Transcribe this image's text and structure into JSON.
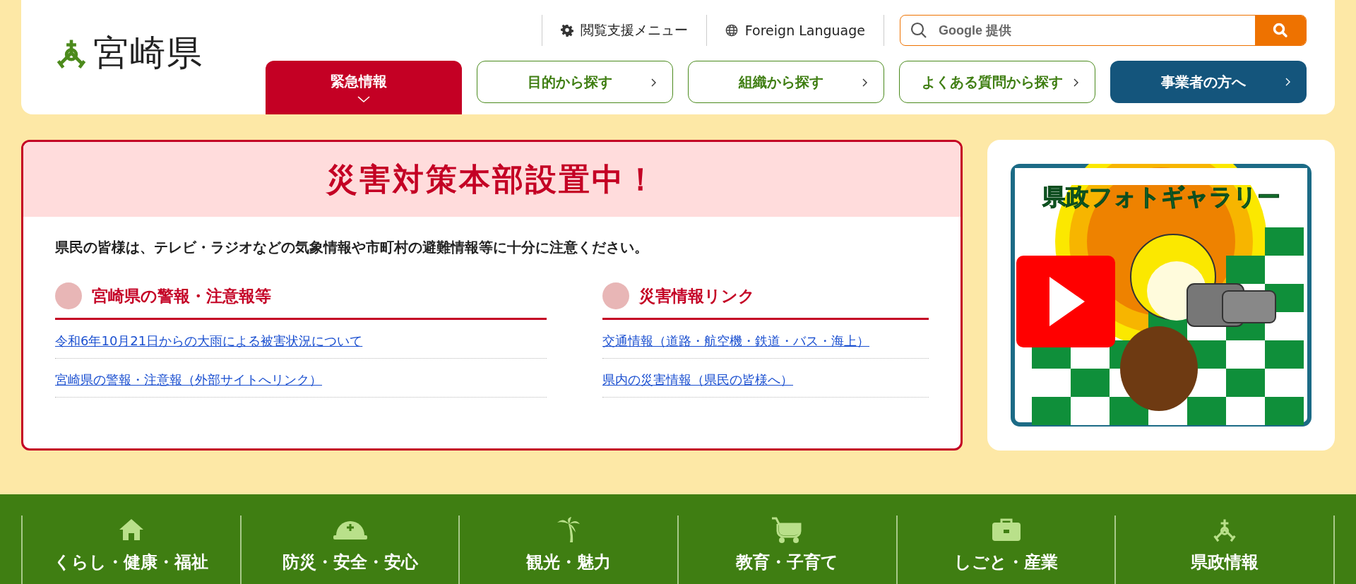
{
  "header": {
    "logo_text": "宮崎県",
    "utility_links": [
      {
        "label": "閲覧支援メニュー"
      },
      {
        "label": "Foreign Language"
      }
    ],
    "search": {
      "placeholder": "Google 提供"
    },
    "nav_tabs": [
      {
        "label": "緊急情報",
        "kind": "emergency"
      },
      {
        "label": "目的から探す",
        "kind": "outline"
      },
      {
        "label": "組織から探す",
        "kind": "outline"
      },
      {
        "label": "よくある質問から探す",
        "kind": "outline"
      },
      {
        "label": "事業者の方へ",
        "kind": "business"
      }
    ]
  },
  "alert": {
    "title": "災害対策本部設置中！",
    "notice": "県民の皆様は、テレビ・ラジオなどの気象情報や市町村の避難情報等に十分に注意ください。",
    "sections": [
      {
        "heading": "宮崎県の警報・注意報等",
        "links": [
          "令和6年10月21日からの大雨による被害状況について",
          "宮崎県の警報・注意報（外部サイトへリンク）"
        ]
      },
      {
        "heading": "災害情報リンク",
        "links": [
          "交通情報（道路・航空機・鉄道・バス・海上）",
          "県内の災害情報（県民の皆様へ）"
        ]
      }
    ]
  },
  "banner": {
    "title": "県政フォトギャラリー"
  },
  "bottom_nav": [
    {
      "label": "くらし・健康・福祉"
    },
    {
      "label": "防災・安全・安心"
    },
    {
      "label": "観光・魅力"
    },
    {
      "label": "教育・子育て"
    },
    {
      "label": "しごと・産業"
    },
    {
      "label": "県政情報"
    }
  ]
}
